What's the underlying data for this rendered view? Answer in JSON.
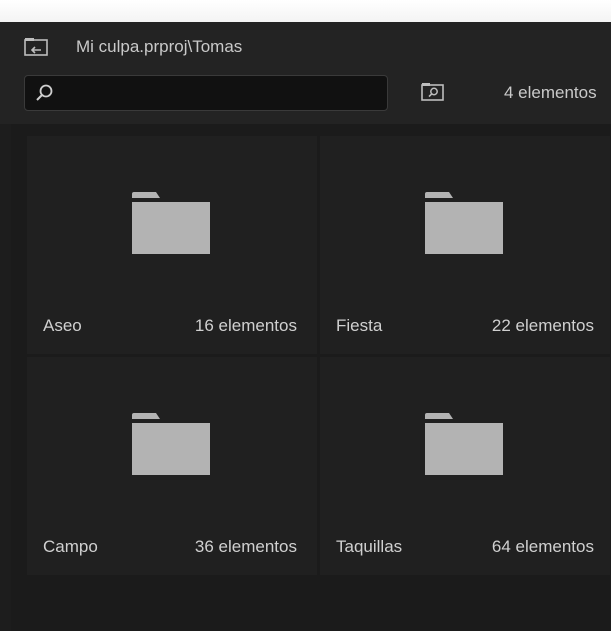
{
  "header": {
    "path": "Mi culpa.prproj\\Tomas",
    "search_placeholder": "",
    "item_count": "4 elementos"
  },
  "bins": [
    {
      "name": "Aseo",
      "count": "16 elementos"
    },
    {
      "name": "Fiesta",
      "count": "22 elementos"
    },
    {
      "name": "Campo",
      "count": "36 elementos"
    },
    {
      "name": "Taquillas",
      "count": "64 elementos"
    }
  ],
  "icons": {
    "up": "navigate-up-icon",
    "search": "search-icon",
    "bin_search": "find-bin-icon",
    "folder": "folder-icon"
  },
  "colors": {
    "background": "#1d1d1d",
    "header": "#232323",
    "tile": "#202020",
    "folder": "#b3b3b3",
    "text": "#cfcfcf"
  }
}
